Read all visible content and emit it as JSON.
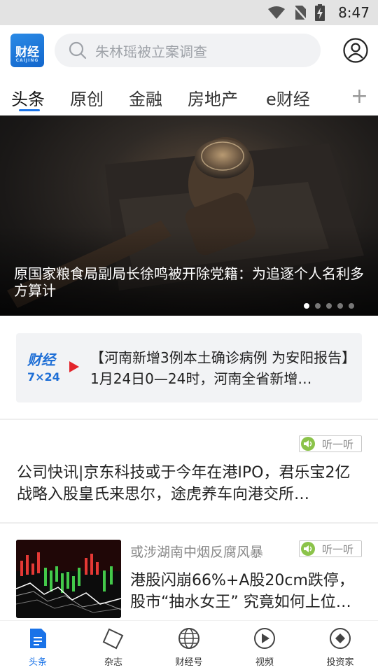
{
  "status": {
    "time": "8:47"
  },
  "header": {
    "logo_text": "财经",
    "logo_sub": "CAIJING",
    "search_placeholder": "朱林瑶被立案调查"
  },
  "tabs": [
    "头条",
    "原创",
    "金融",
    "房地产",
    "e财经"
  ],
  "hero": {
    "caption": "原国家粮食局副局长徐鸣被开除党籍：为追逐个人名利多方算计",
    "slides": 5,
    "active_slide": 1
  },
  "flash": {
    "logo_top": "财经",
    "logo_sub": "7×24",
    "text": "【河南新增3例本土确诊病例 为安阳报告】1月24日0—24时，河南全省新增…"
  },
  "articles": [
    {
      "listen_label": "听一听",
      "title": "公司快讯|京东科技或于今年在港IPO，君乐宝2亿战略入股皇氏来思尔，途虎养车向港交所…"
    },
    {
      "meta": "或涉湖南中烟反腐风暴",
      "listen_label": "听一听",
      "title": "港股闪崩66%+A股20cm跌停，股市“抽水女王” 究竟如何上位…"
    }
  ],
  "bottom_nav": [
    {
      "label": "头条",
      "icon": "document-icon",
      "active": true
    },
    {
      "label": "杂志",
      "icon": "magazine-icon",
      "active": false
    },
    {
      "label": "财经号",
      "icon": "globe-icon",
      "active": false
    },
    {
      "label": "视频",
      "icon": "play-icon",
      "active": false
    },
    {
      "label": "投资家",
      "icon": "diamond-icon",
      "active": false
    }
  ],
  "colors": {
    "accent": "#1a73e8",
    "flash_red": "#e3242b",
    "listen_green": "#8bc34a"
  }
}
